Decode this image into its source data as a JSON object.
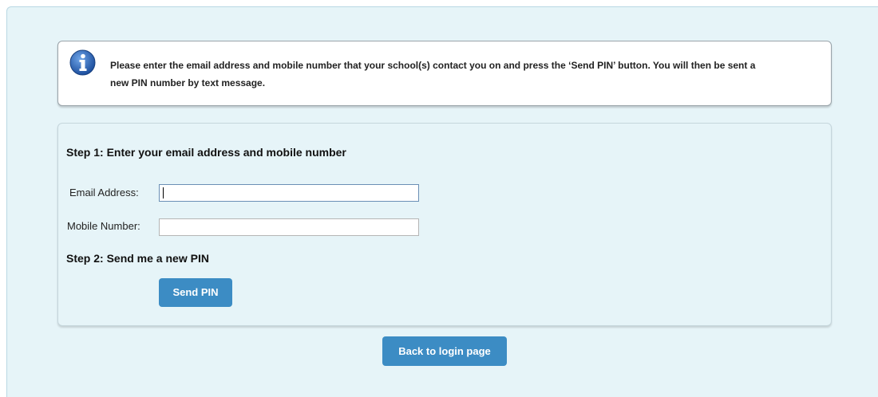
{
  "info": {
    "icon": "info-icon",
    "message": "Please enter the email address and mobile number that your school(s) contact you on and press the ‘Send PIN’ button. You will then be sent a new PIN number by text message."
  },
  "form": {
    "step1_heading": "Step 1: Enter your email address and mobile number",
    "email_label": "Email Address:",
    "email_value": "",
    "mobile_label": "Mobile Number:",
    "mobile_value": "",
    "step2_heading": "Step 2: Send me a new PIN",
    "send_pin_label": "Send PIN"
  },
  "footer": {
    "back_label": "Back to login page"
  },
  "colors": {
    "panel_background": "#e6f4f8",
    "button": "#3c8cc4",
    "info_icon": "#2a63b0"
  }
}
